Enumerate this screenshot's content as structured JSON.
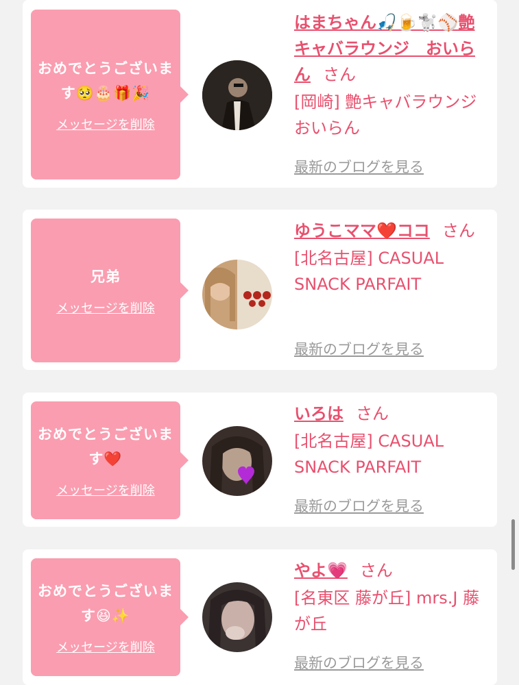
{
  "items": [
    {
      "message": "おめでとうございます🥺🎂🎁🎉",
      "delete_label": "メッセージを削除",
      "name": "はまちゃん🎣🍺🐩⚾艶キャバラウンジ　おいらん",
      "honorific": "さん",
      "shop": "[岡崎] 艶キャバラウンジ おいらん",
      "blog_link": "最新のブログを見る",
      "avatar_colors": [
        "#2a2420",
        "#8a7a6a"
      ]
    },
    {
      "message": "兄弟",
      "delete_label": "メッセージを削除",
      "name": "ゆうこママ❤️ココ",
      "honorific": "さん",
      "shop": "[北名古屋] CASUAL SNACK PARFAIT",
      "blog_link": "最新のブログを見る",
      "avatar_colors": [
        "#c9a27a",
        "#e8dccb"
      ]
    },
    {
      "message": "おめでとうございます❤️",
      "delete_label": "メッセージを削除",
      "name": "いろは",
      "honorific": "さん",
      "shop": "[北名古屋] CASUAL SNACK PARFAIT",
      "blog_link": "最新のブログを見る",
      "avatar_colors": [
        "#3a2e2a",
        "#b8a08e"
      ]
    },
    {
      "message": "おめでとうございます😆✨",
      "delete_label": "メッセージを削除",
      "name": "やよ💗",
      "honorific": "さん",
      "shop": "[名東区 藤が丘] mrs.J 藤が丘",
      "blog_link": "最新のブログを見る",
      "avatar_colors": [
        "#3b3232",
        "#c9b0a8"
      ]
    }
  ],
  "colors": {
    "bubble": "#fa9db0",
    "accent": "#e8506e",
    "link_gray": "#9a9a9a",
    "background": "#f2f2f2"
  }
}
